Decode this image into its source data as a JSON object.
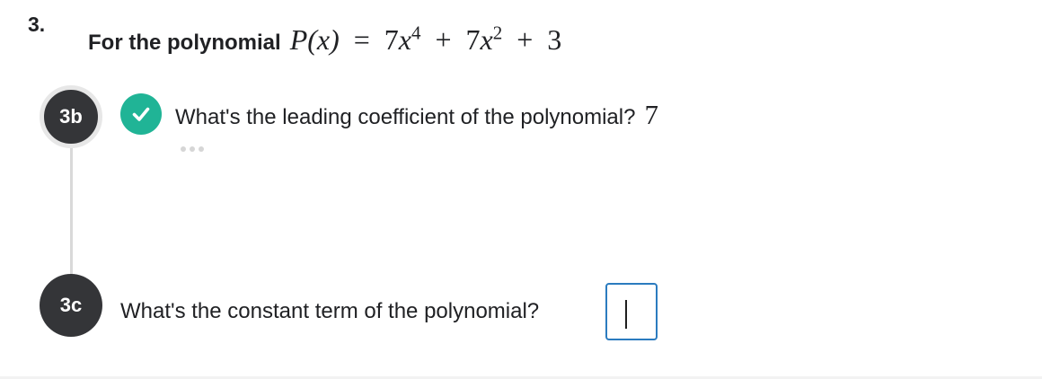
{
  "problem": {
    "number": "3.",
    "prompt": "For the polynomial",
    "polynomial": {
      "lhs": "P(x)",
      "eq": "=",
      "coef1": "7",
      "var1": "x",
      "exp1": "4",
      "plus1": "+",
      "coef2": "7",
      "var2": "x",
      "exp2": "2",
      "plus2": "+",
      "constant": "3"
    }
  },
  "steps": [
    {
      "label": "3b",
      "status": "correct",
      "question": "What's the leading coefficient of the polynomial?",
      "answer": "7"
    },
    {
      "label": "3c",
      "status": "active",
      "question": "What's the constant term of the polynomial?",
      "answer": ""
    }
  ],
  "colors": {
    "badge": "#343538",
    "check": "#20b496",
    "input_border": "#2b7bbf",
    "timeline": "#d9d9d9"
  },
  "icons": {
    "check": "check-icon",
    "more": "more-options-icon"
  }
}
